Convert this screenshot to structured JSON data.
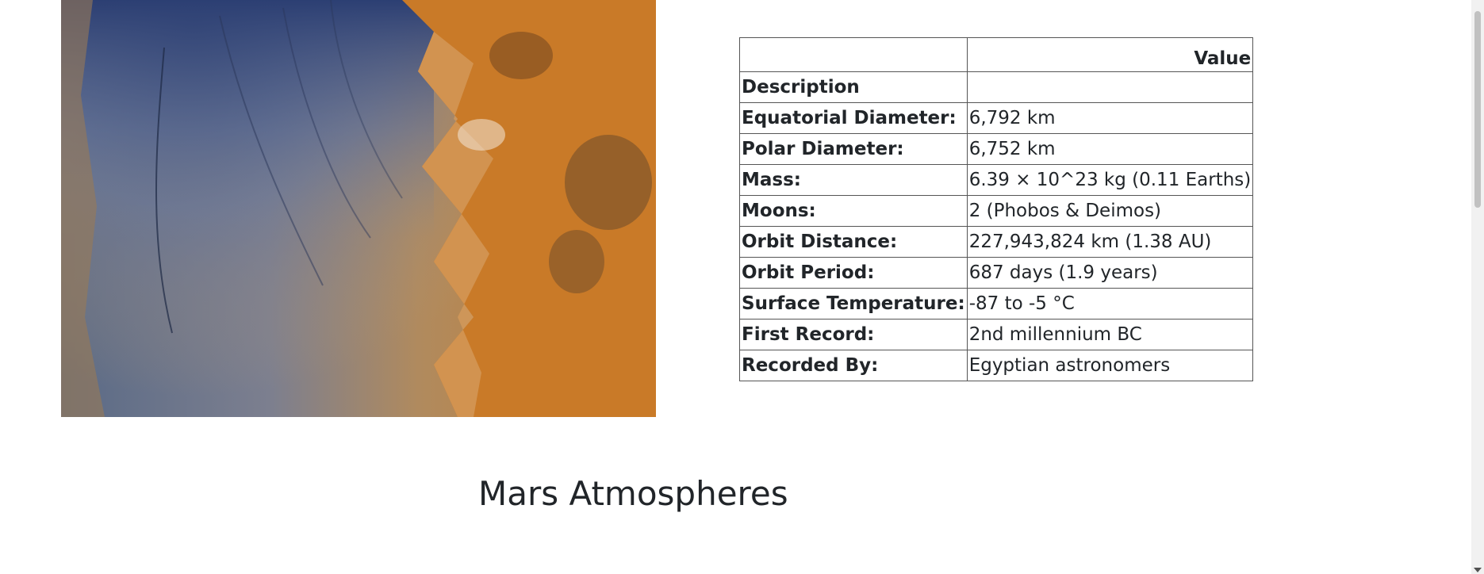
{
  "image": {
    "alt_icon": "mars-surface-image"
  },
  "facts_table": {
    "header": {
      "blank": "",
      "value": "Value"
    },
    "rows": [
      {
        "label": "Description",
        "value": ""
      },
      {
        "label": "Equatorial Diameter:",
        "value": "6,792 km"
      },
      {
        "label": "Polar Diameter:",
        "value": "6,752 km"
      },
      {
        "label": "Mass:",
        "value": "6.39 × 10^23 kg (0.11 Earths)"
      },
      {
        "label": "Moons:",
        "value": "2 (Phobos & Deimos)"
      },
      {
        "label": "Orbit Distance:",
        "value": "227,943,824 km (1.38 AU)"
      },
      {
        "label": "Orbit Period:",
        "value": "687 days (1.9 years)"
      },
      {
        "label": "Surface Temperature:",
        "value": "-87 to -5 °C"
      },
      {
        "label": "First Record:",
        "value": "2nd millennium BC"
      },
      {
        "label": "Recorded By:",
        "value": "Egyptian astronomers"
      }
    ]
  },
  "section_heading": "Mars Atmospheres"
}
